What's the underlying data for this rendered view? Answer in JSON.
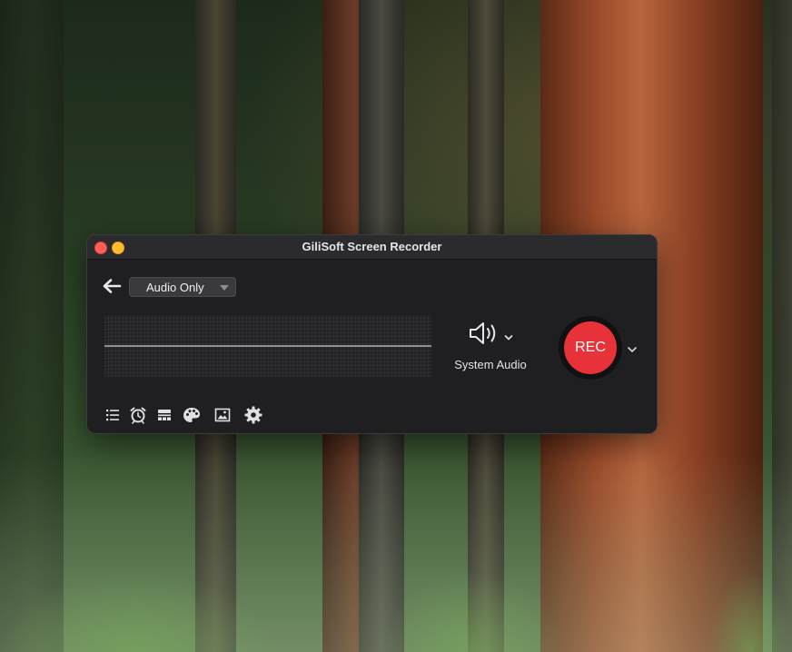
{
  "window": {
    "title": "GiliSoft Screen Recorder"
  },
  "toolbar": {
    "mode_select": {
      "selected": "Audio Only"
    }
  },
  "audio": {
    "source_label": "System Audio",
    "icon": "speaker-icon"
  },
  "record": {
    "button_label": "REC",
    "color": "#e8323a"
  },
  "bottom_tools": [
    {
      "icon": "list-icon"
    },
    {
      "icon": "alarm-clock-icon"
    },
    {
      "icon": "watermark-icon"
    },
    {
      "icon": "palette-icon"
    },
    {
      "icon": "image-icon"
    },
    {
      "icon": "gear-icon"
    }
  ],
  "colors": {
    "window_bg": "#1f1f22",
    "titlebar_bg": "#2b2b2e",
    "close": "#fe5f57",
    "minimize": "#febc2e"
  }
}
